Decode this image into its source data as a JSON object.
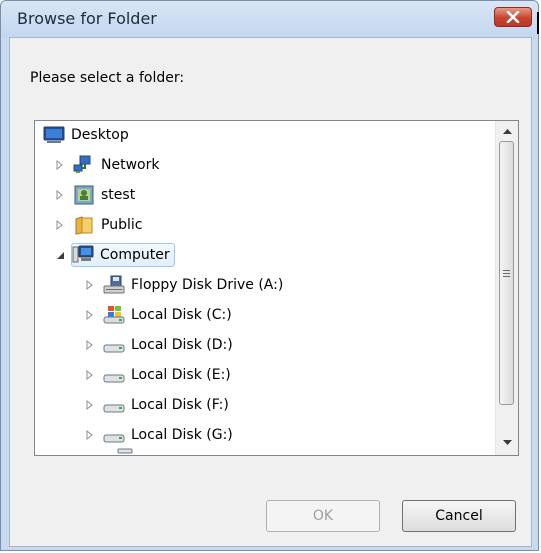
{
  "dialog": {
    "title": "Browse for Folder",
    "prompt": "Please select a folder:",
    "ok_label": "OK",
    "cancel_label": "Cancel",
    "ok_enabled": false
  },
  "tree": {
    "items": [
      {
        "label": "Desktop",
        "icon": "desktop-icon",
        "expander": "none"
      },
      {
        "label": "Network",
        "icon": "network-icon",
        "expander": "collapsed"
      },
      {
        "label": "stest",
        "icon": "user-folder-icon",
        "expander": "collapsed"
      },
      {
        "label": "Public",
        "icon": "folder-icon",
        "expander": "collapsed"
      },
      {
        "label": "Computer",
        "icon": "computer-icon",
        "expander": "expanded",
        "selected": true
      },
      {
        "label": "Floppy Disk Drive (A:)",
        "icon": "floppy-drive-icon",
        "expander": "collapsed"
      },
      {
        "label": "Local Disk (C:)",
        "icon": "system-drive-icon",
        "expander": "collapsed"
      },
      {
        "label": "Local Disk (D:)",
        "icon": "hard-drive-icon",
        "expander": "collapsed"
      },
      {
        "label": "Local Disk (E:)",
        "icon": "hard-drive-icon",
        "expander": "collapsed"
      },
      {
        "label": "Local Disk (F:)",
        "icon": "hard-drive-icon",
        "expander": "collapsed"
      },
      {
        "label": "Local Disk (G:)",
        "icon": "hard-drive-icon",
        "expander": "collapsed"
      }
    ]
  },
  "colors": {
    "title_bg": "#c8daf0",
    "close_red": "#c9452f",
    "selection_border": "#9fc9ea",
    "dialog_bg": "#f0f0f0"
  }
}
